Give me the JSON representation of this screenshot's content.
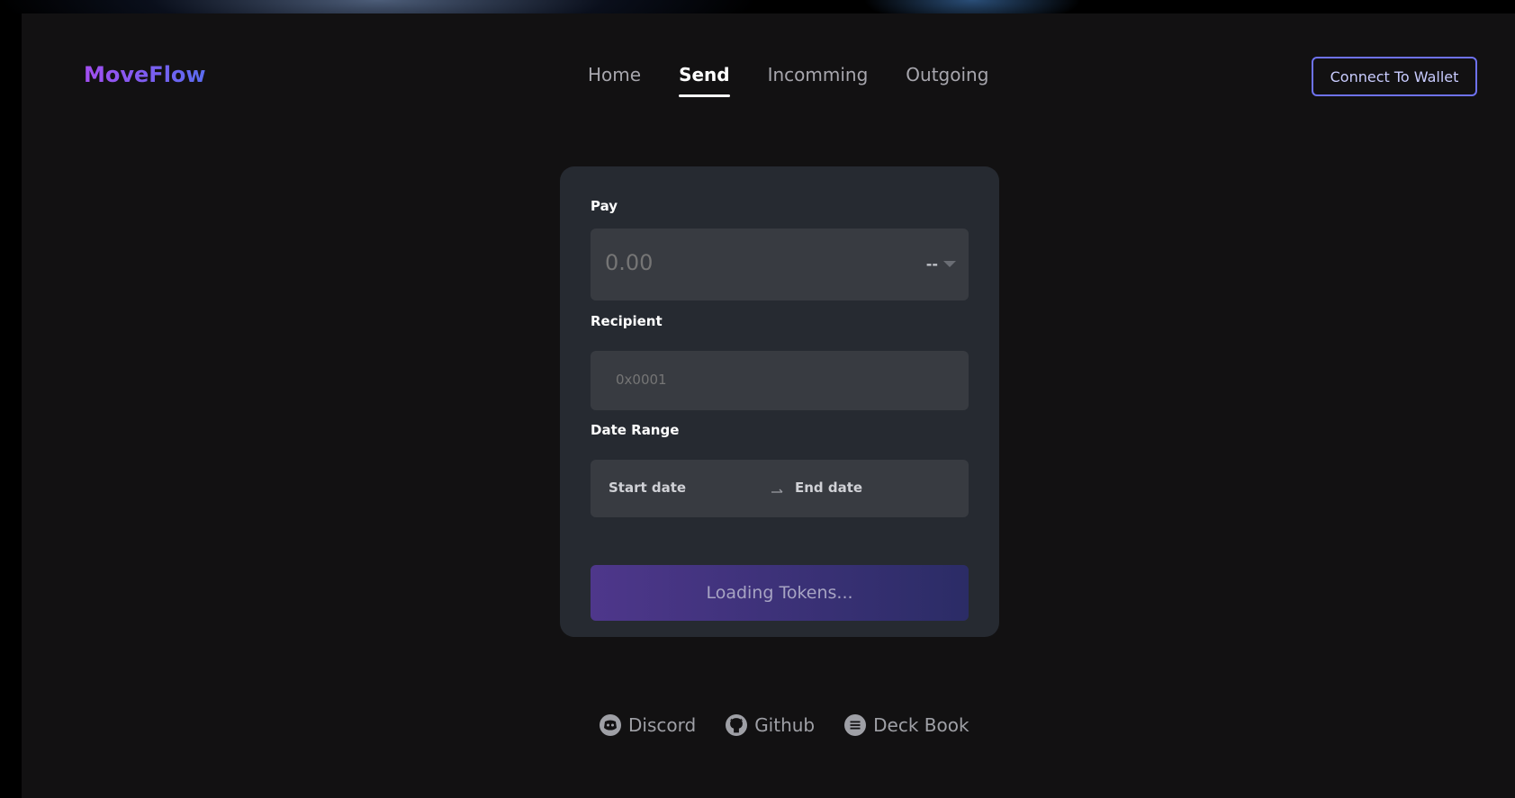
{
  "brand": {
    "name": "MoveFlow"
  },
  "nav": {
    "items": [
      {
        "label": "Home",
        "active": false
      },
      {
        "label": "Send",
        "active": true
      },
      {
        "label": "Incomming",
        "active": false
      },
      {
        "label": "Outgoing",
        "active": false
      }
    ]
  },
  "header": {
    "connect_label": "Connect To Wallet"
  },
  "form": {
    "pay_label": "Pay",
    "pay_placeholder": "0.00",
    "token_value": "--",
    "recipient_label": "Recipient",
    "recipient_placeholder": "0x0001",
    "date_range_label": "Date Range",
    "start_date_placeholder": "Start date",
    "end_date_placeholder": "End date",
    "submit_label": "Loading Tokens..."
  },
  "footer": {
    "links": [
      {
        "label": "Discord",
        "icon": "discord-icon"
      },
      {
        "label": "Github",
        "icon": "github-icon"
      },
      {
        "label": "Deck Book",
        "icon": "book-icon"
      }
    ]
  },
  "colors": {
    "background": "#121112",
    "card": "#262a31",
    "field": "#383b41",
    "accent": "#6e72f0",
    "brand_start": "#a24ef0",
    "brand_end": "#5a6cf0"
  }
}
